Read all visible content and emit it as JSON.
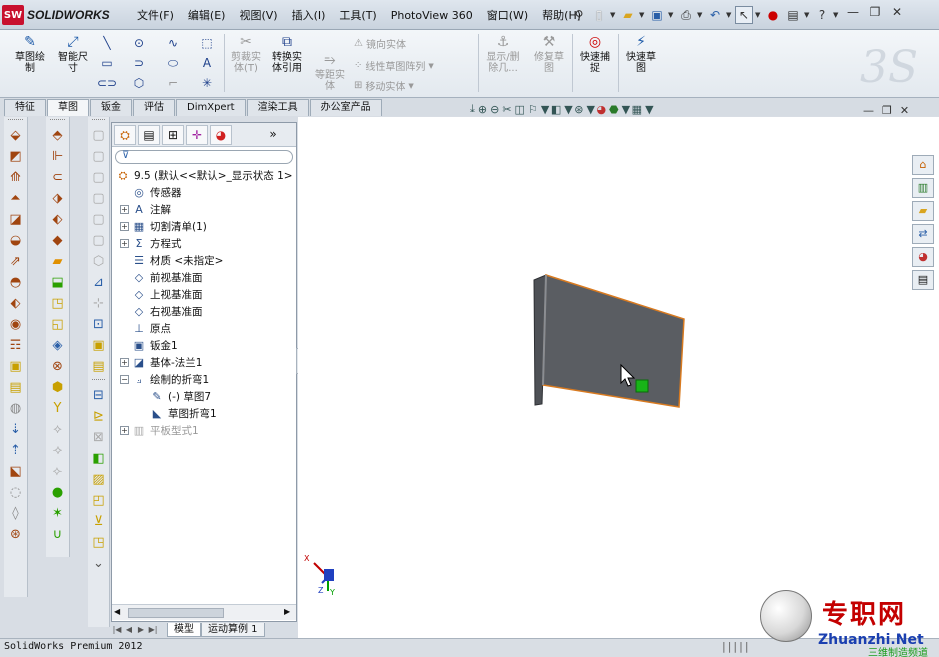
{
  "app": {
    "logo_badge": "SW",
    "logo_text": "SOLIDWORKS"
  },
  "menu": [
    "文件(F)",
    "编辑(E)",
    "视图(V)",
    "插入(I)",
    "工具(T)",
    "PhotoView 360",
    "窗口(W)",
    "帮助(H)"
  ],
  "menu_toolbar": {
    "help": "?"
  },
  "ribbon": {
    "sketch": "草图绘\n制",
    "smart_dim": "智能尺\n寸",
    "trim": "剪裁实\n体(T)",
    "convert": "转换实\n体引用",
    "offset": "等距实\n体",
    "mirror": "镜向实体",
    "linear_pattern": "线性草图阵列",
    "move": "移动实体",
    "show_hide": "显示/删\n除几...",
    "repair": "修复草\n图",
    "quick_snap": "快速捕\n捉",
    "rapid_sketch": "快速草\n图"
  },
  "tabs": [
    "特征",
    "草图",
    "钣金",
    "评估",
    "DimXpert",
    "渲染工具",
    "办公室产品"
  ],
  "active_tab": "草图",
  "tree": {
    "root": "9.5  (默认<<默认>_显示状态 1>",
    "items": [
      {
        "label": "传感器",
        "icon": "sensor-icon",
        "expand": false
      },
      {
        "label": "注解",
        "icon": "annotation-icon",
        "expand": true
      },
      {
        "label": "切割清单(1)",
        "icon": "cut-list-icon",
        "expand": true
      },
      {
        "label": "方程式",
        "icon": "equation-icon",
        "expand": true
      },
      {
        "label": "材质 <未指定>",
        "icon": "material-icon",
        "expand": false
      },
      {
        "label": "前视基准面",
        "icon": "plane-icon",
        "expand": false
      },
      {
        "label": "上视基准面",
        "icon": "plane-icon",
        "expand": false
      },
      {
        "label": "右视基准面",
        "icon": "plane-icon",
        "expand": false
      },
      {
        "label": "原点",
        "icon": "origin-icon",
        "expand": false
      },
      {
        "label": "钣金1",
        "icon": "sheet-metal-icon",
        "expand": false
      },
      {
        "label": "基体-法兰1",
        "icon": "base-flange-icon",
        "expand": true
      },
      {
        "label": "绘制的折弯1",
        "icon": "sketched-bend-icon",
        "expand": "open"
      },
      {
        "label": "(-) 草图7",
        "icon": "sketch-icon",
        "expand": false
      },
      {
        "label": "草图折弯1",
        "icon": "bend-icon",
        "expand": false
      },
      {
        "label": "平板型式1",
        "icon": "flat-pattern-icon",
        "expand": true,
        "dim": true
      }
    ]
  },
  "bottom_tabs": [
    "模型",
    "运动算例 1"
  ],
  "status": "SolidWorks Premium 2012",
  "watermark": {
    "cn": "专职网",
    "en": "Zhuanzhi.Net",
    "sub": "三维制造频道"
  },
  "triad": {
    "x": "X",
    "y": "Y",
    "z": "Z"
  },
  "colors": {
    "accent_orange": "#e07010",
    "part_gray": "#5a5d62",
    "edge_orange": "#d87a20",
    "handle_green": "#18b418"
  }
}
